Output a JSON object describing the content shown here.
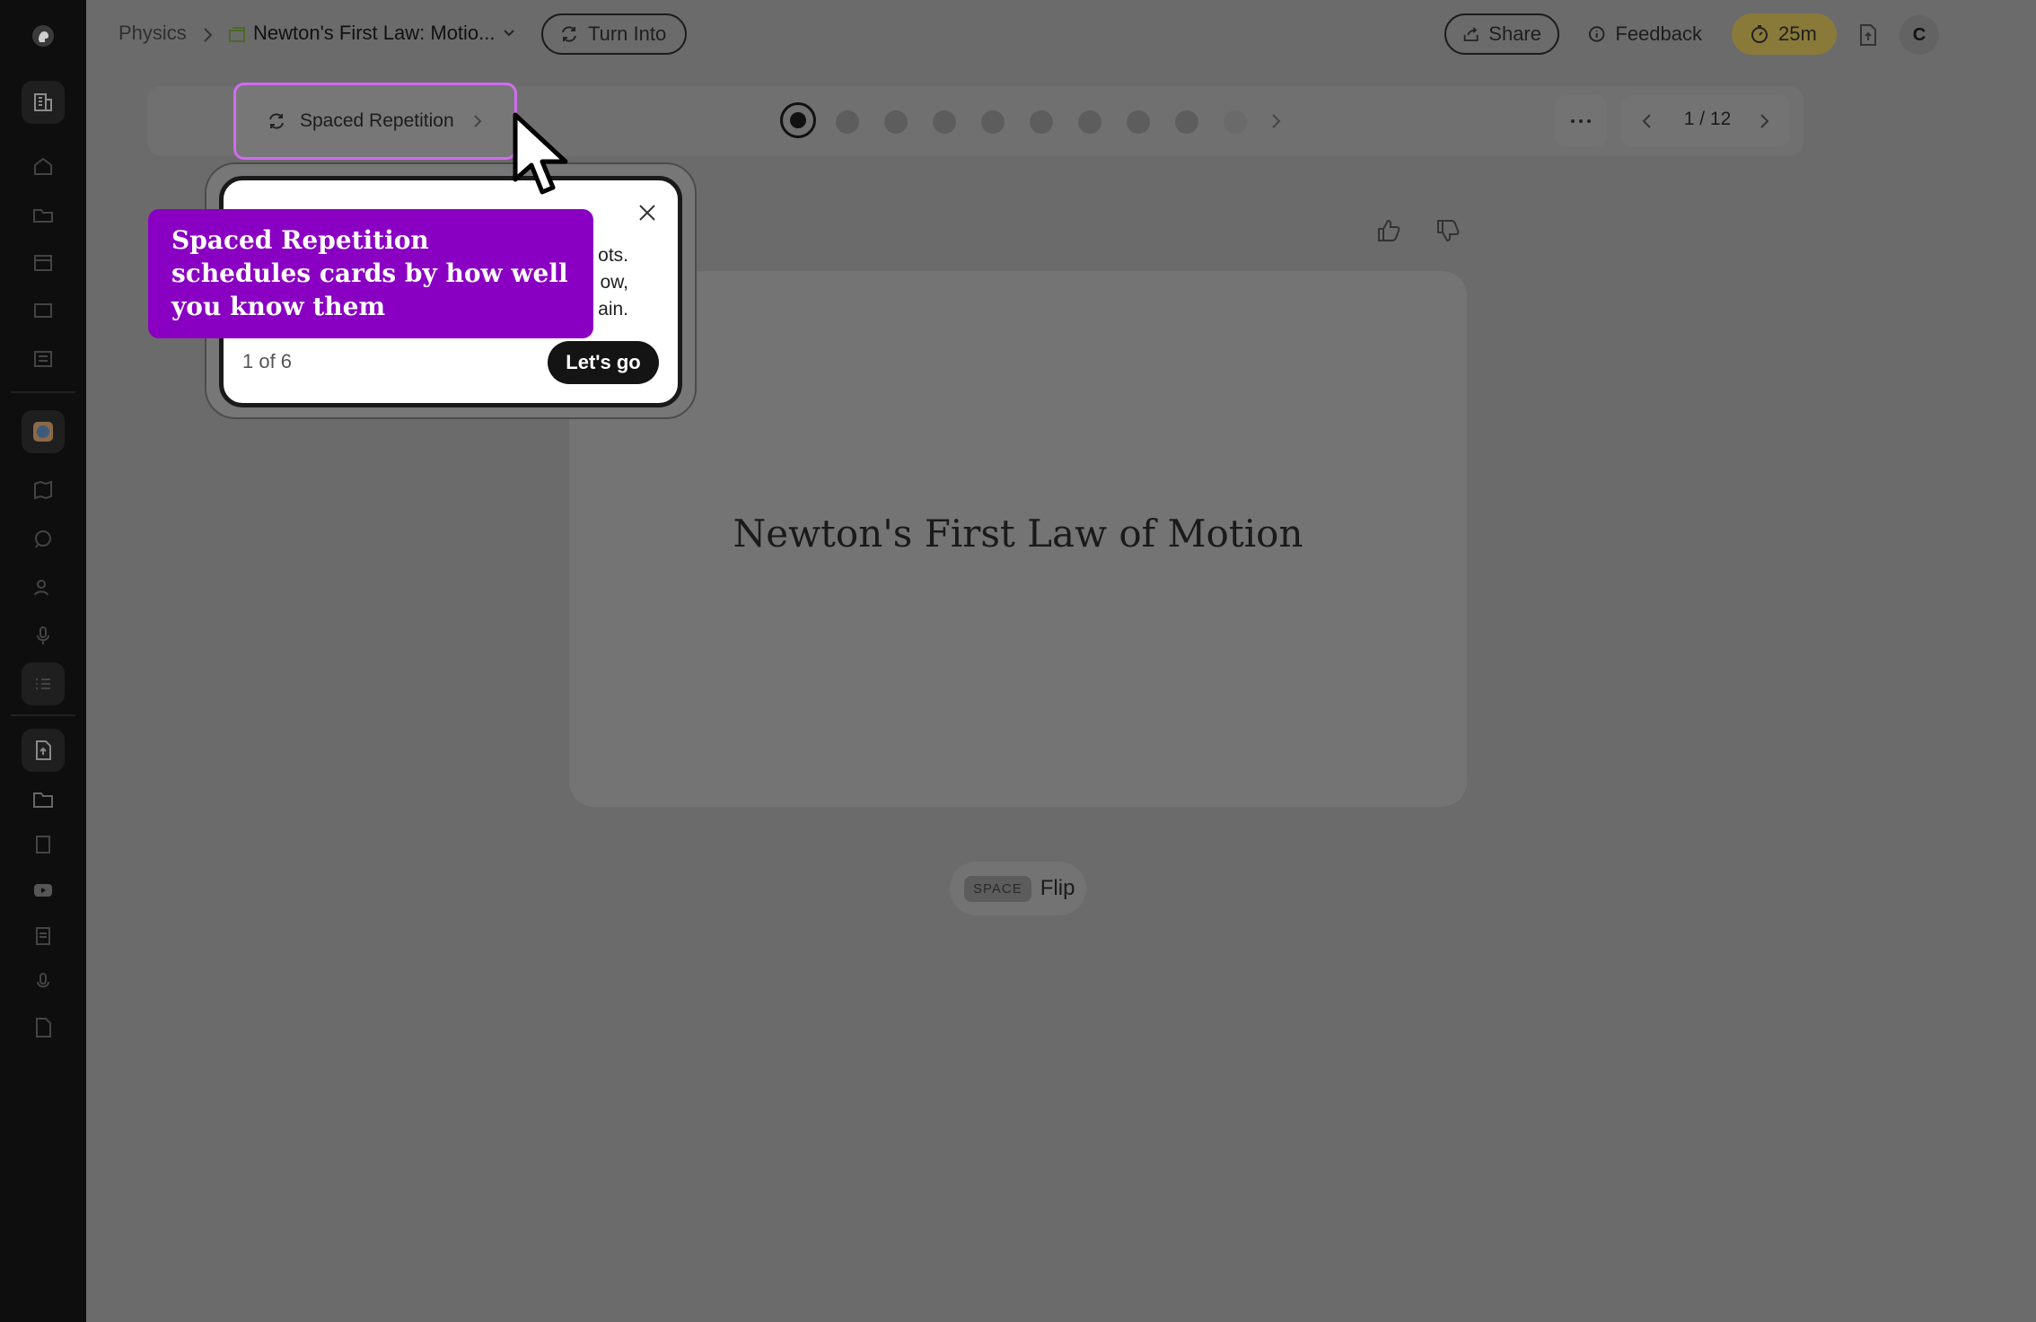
{
  "breadcrumb": {
    "root": "Physics",
    "current": "Newton's First Law: Motio..."
  },
  "header": {
    "turn_into": "Turn Into",
    "share": "Share",
    "feedback": "Feedback",
    "timer": "25m",
    "avatar": "C"
  },
  "toolbar": {
    "mode": "Spaced Repetition",
    "counter": "1 / 12"
  },
  "card": {
    "front": "Newton's First Law of Motion"
  },
  "flip": {
    "key": "SPACE",
    "label": "Flip"
  },
  "tour": {
    "body_fragment": "ots.\now,\nain.",
    "progress": "1 of 6",
    "cta": "Let's go"
  },
  "annotation": {
    "text": "Spaced Repetition schedules cards by how well you know them"
  },
  "colors": {
    "highlight": "#d06cf0",
    "annotation": "#8a00c2",
    "timer": "#b8a23a"
  }
}
